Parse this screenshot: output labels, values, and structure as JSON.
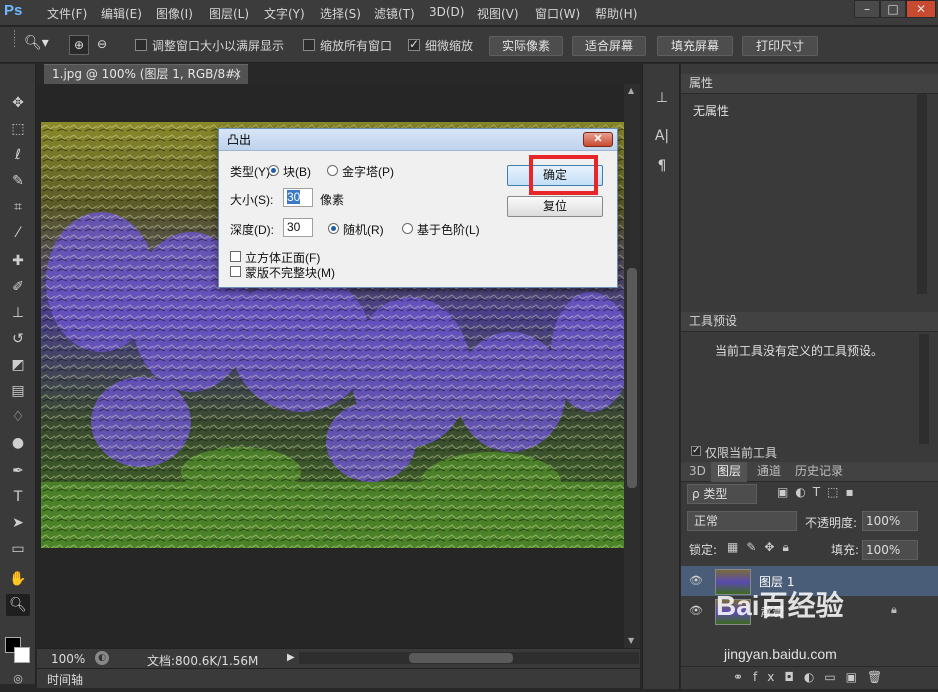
{
  "app": {
    "logo": "Ps"
  },
  "menu": [
    "文件(F)",
    "编辑(E)",
    "图像(I)",
    "图层(L)",
    "文字(Y)",
    "选择(S)",
    "滤镜(T)",
    "3D(D)",
    "视图(V)",
    "窗口(W)",
    "帮助(H)"
  ],
  "window_controls": {
    "minimize": "–",
    "restore": "□",
    "close": "✕"
  },
  "options": {
    "resize_windows_label": "调整窗口大小以满屏显示",
    "zoom_all_label": "缩放所有窗口",
    "scrubby_zoom_label": "细微缩放",
    "resize_windows_checked": false,
    "zoom_all_checked": false,
    "scrubby_zoom_checked": true,
    "actual_pixels": "实际像素",
    "fit_screen": "适合屏幕",
    "fill_screen": "填充屏幕",
    "print_size": "打印尺寸"
  },
  "document": {
    "tab_title": "1.jpg @ 100% (图层 1, RGB/8#) *",
    "zoom": "100%",
    "doc_info": "文档:800.6K/1.56M"
  },
  "timeline_label": "时间轴",
  "dialog": {
    "title": "凸出",
    "type_label": "类型(Y):",
    "type_block": "块(B)",
    "type_pyramid": "金字塔(P)",
    "size_label": "大小(S):",
    "size_value": "30",
    "size_unit": "像素",
    "depth_label": "深度(D):",
    "depth_value": "30",
    "depth_random": "随机(R)",
    "depth_level": "基于色阶(L)",
    "solid_front": "立方体正面(F)",
    "mask_incomplete": "蒙版不完整块(M)",
    "ok": "确定",
    "reset": "复位"
  },
  "properties_panel": {
    "title": "属性",
    "content": "无属性"
  },
  "tool_presets_panel": {
    "title": "工具预设",
    "content": "当前工具没有定义的工具预设。",
    "current_only": "仅限当前工具"
  },
  "layers_panel": {
    "tabs": [
      "3D",
      "图层",
      "通道",
      "历史记录"
    ],
    "active_tab": "图层",
    "filter_label": "ρ 类型",
    "blend_mode": "正常",
    "opacity_label": "不透明度:",
    "opacity_value": "100%",
    "lock_label": "锁定:",
    "fill_label": "填充:",
    "fill_value": "100%",
    "layers": [
      {
        "name": "图层 1",
        "selected": true
      },
      {
        "name": "背景",
        "selected": false
      }
    ]
  },
  "watermark": {
    "brand": "Bai百经验",
    "url": "jingyan.baidu.com"
  },
  "colors": {
    "accent": "#e8262a",
    "selected_layer": "#4a5d78",
    "dialog_title": "#c4d7ee"
  }
}
